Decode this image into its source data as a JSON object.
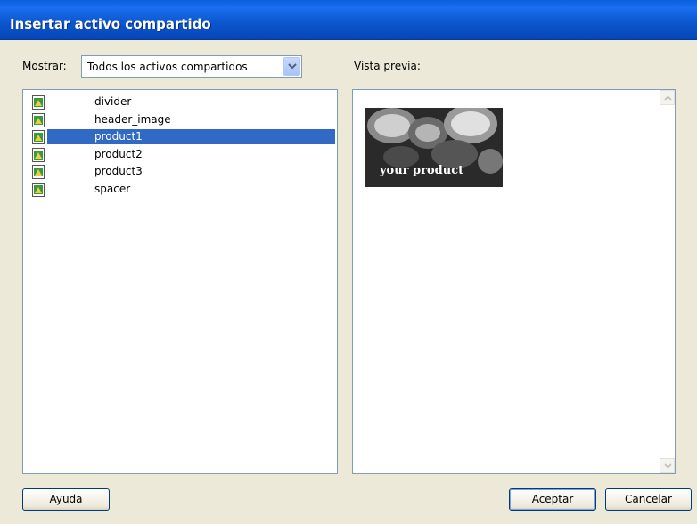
{
  "window": {
    "title": "Insertar activo compartido"
  },
  "filter": {
    "label": "Mostrar:",
    "selected": "Todos los activos compartidos"
  },
  "preview": {
    "label": "Vista previa:",
    "image_caption": "your product"
  },
  "assets": [
    {
      "name": "divider",
      "selected": false
    },
    {
      "name": "header_image",
      "selected": false
    },
    {
      "name": "product1",
      "selected": true
    },
    {
      "name": "product2",
      "selected": false
    },
    {
      "name": "product3",
      "selected": false
    },
    {
      "name": "spacer",
      "selected": false
    }
  ],
  "buttons": {
    "help": "Ayuda",
    "ok": "Aceptar",
    "cancel": "Cancelar"
  },
  "colors": {
    "selection": "#316ac5",
    "titlebar": "#0a5fdc"
  },
  "icons": {
    "asset": "image-file-icon",
    "dropdown": "chevron-down-icon"
  }
}
